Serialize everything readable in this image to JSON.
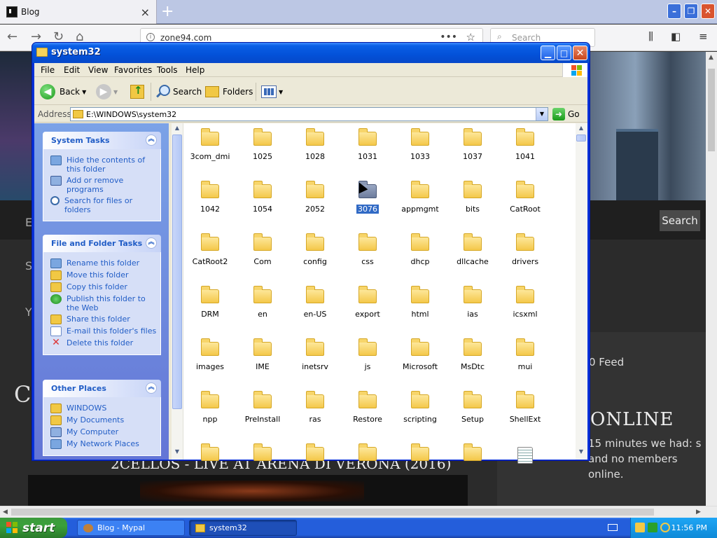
{
  "browser": {
    "tab_title": "Blog",
    "close_glyph": "×",
    "newtab_glyph": "+",
    "url": "zone94.com",
    "search_placeholder": "Search",
    "page": {
      "search_button": "Search",
      "feed_text": "0 Feed",
      "online_title": "ONLINE",
      "online_text": "15 minutes we had: s and no members online.",
      "video_title": "2CELLOS - LIVE AT ARENA DI VERONA (2016)",
      "big_heading": "CE"
    }
  },
  "explorer": {
    "title": "system32",
    "menu": [
      "File",
      "Edit",
      "View",
      "Favorites",
      "Tools",
      "Help"
    ],
    "toolbar": {
      "back": "Back",
      "search": "Search",
      "folders": "Folders"
    },
    "address": {
      "label": "Address",
      "value": "E:\\WINDOWS\\system32",
      "go": "Go"
    },
    "panels": {
      "system_tasks": {
        "title": "System Tasks",
        "items": [
          "Hide the contents of this folder",
          "Add or remove programs",
          "Search for files or folders"
        ]
      },
      "file_folder_tasks": {
        "title": "File and Folder Tasks",
        "items": [
          "Rename this folder",
          "Move this folder",
          "Copy this folder",
          "Publish this folder to the Web",
          "Share this folder",
          "E-mail this folder's files",
          "Delete this folder"
        ]
      },
      "other_places": {
        "title": "Other Places",
        "items": [
          "WINDOWS",
          "My Documents",
          "My Computer",
          "My Network Places"
        ]
      }
    },
    "selected_item": "3076",
    "items": [
      "3com_dmi",
      "1025",
      "1028",
      "1031",
      "1033",
      "1037",
      "1041",
      "1042",
      "1054",
      "2052",
      "3076",
      "appmgmt",
      "bits",
      "CatRoot",
      "CatRoot2",
      "Com",
      "config",
      "css",
      "dhcp",
      "dllcache",
      "drivers",
      "DRM",
      "en",
      "en-US",
      "export",
      "html",
      "ias",
      "icsxml",
      "images",
      "IME",
      "inetsrv",
      "js",
      "Microsoft",
      "MsDtc",
      "mui",
      "npp",
      "PreInstall",
      "ras",
      "Restore",
      "scripting",
      "Setup",
      "ShellExt"
    ]
  },
  "taskbar": {
    "start": "start",
    "buttons": [
      {
        "label": "Blog - Mypal",
        "active": false
      },
      {
        "label": "system32",
        "active": true
      }
    ],
    "clock": "11:56 PM"
  },
  "colors": {
    "xp_blue": "#0831d9",
    "taskpane": "#6375d6",
    "start_green": "#3aa03a",
    "selection": "#316ac5"
  }
}
